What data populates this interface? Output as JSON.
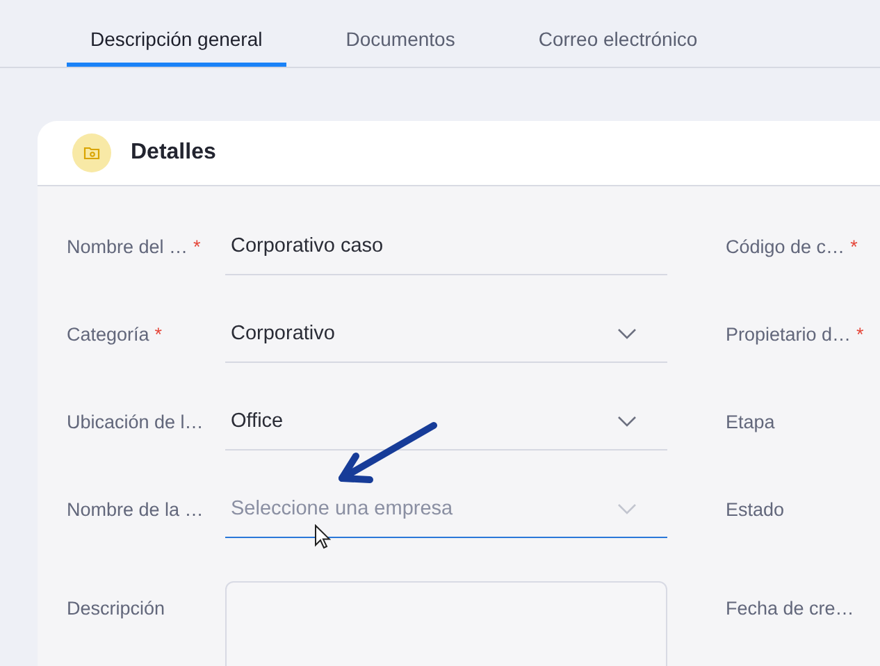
{
  "tabs": [
    {
      "label": "Descripción general",
      "selected": true
    },
    {
      "label": "Documentos",
      "selected": false
    },
    {
      "label": "Correo electrónico",
      "selected": false
    }
  ],
  "card": {
    "title": "Detalles"
  },
  "rows": [
    {
      "left": {
        "label": "Nombre del …",
        "required_mark": "*",
        "kind": "text",
        "value": "Corporativo caso",
        "focused": false
      },
      "right": {
        "label": "Código de c…",
        "required_mark": "*"
      }
    },
    {
      "left": {
        "label": "Categoría",
        "required_mark": "*",
        "kind": "select",
        "value": "Corporativo",
        "focused": false
      },
      "right": {
        "label": "Propietario d…",
        "required_mark": "*"
      }
    },
    {
      "left": {
        "label": "Ubicación de l…",
        "kind": "select",
        "value": "Office",
        "focused": false
      },
      "right": {
        "label": "Etapa"
      }
    },
    {
      "left": {
        "label": "Nombre de la …",
        "kind": "select",
        "placeholder": "Seleccione una empresa",
        "focused": true
      },
      "right": {
        "label": "Estado"
      }
    },
    {
      "left": {
        "label": "Descripción",
        "kind": "textarea",
        "focused": false
      },
      "right": {
        "label": "Fecha de cre…"
      }
    }
  ]
}
